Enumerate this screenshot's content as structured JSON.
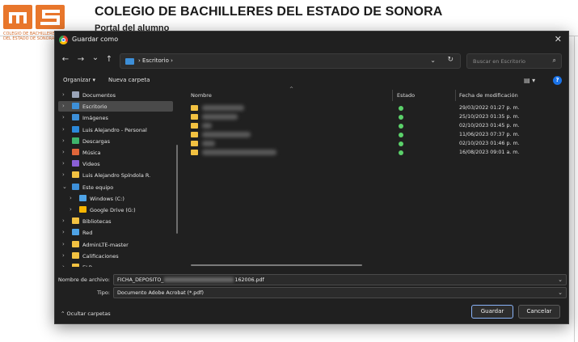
{
  "background": {
    "title": "COLEGIO DE BACHILLERES DEL ESTADO DE SONORA",
    "subtitle": "Portal del alumno",
    "logo_text_line1": "COLEGIO DE BACHILLERES",
    "logo_text_line2": "DEL ESTADO DE SONORA"
  },
  "dialog": {
    "title": "Guardar como",
    "close_glyph": "✕",
    "nav": {
      "back": "←",
      "forward": "→",
      "recent": "⌄",
      "up": "↑"
    },
    "address": {
      "breadcrumb": "› Escritorio ›",
      "dropdown": "⌄",
      "refresh": "↻"
    },
    "search": {
      "placeholder": "Buscar en Escritorio",
      "icon": "⌕"
    },
    "toolbar": {
      "organize": "Organizar ▾",
      "new_folder": "Nueva carpeta",
      "view_glyph": "▤ ▾",
      "help_glyph": "?"
    },
    "sidebar": [
      {
        "label": "Documentos",
        "icon": "document-icon",
        "color": "#9aa4b8",
        "indent": 0,
        "chevron": "›",
        "selected": false
      },
      {
        "label": "Escritorio",
        "icon": "desktop-icon",
        "color": "#3d8fd8",
        "indent": 0,
        "chevron": "›",
        "selected": true
      },
      {
        "label": "Imágenes",
        "icon": "pictures-icon",
        "color": "#3d8fd8",
        "indent": 0,
        "chevron": "›",
        "selected": false
      },
      {
        "label": "Luis Alejandro - Personal",
        "icon": "cloud-icon",
        "color": "#2b88d9",
        "indent": 0,
        "chevron": "›",
        "selected": false
      },
      {
        "label": "Descargas",
        "icon": "download-icon",
        "color": "#3fb36b",
        "indent": 0,
        "chevron": "›",
        "selected": false
      },
      {
        "label": "Música",
        "icon": "music-icon",
        "color": "#e0663a",
        "indent": 0,
        "chevron": "›",
        "selected": false
      },
      {
        "label": "Videos",
        "icon": "videos-icon",
        "color": "#8a5fd6",
        "indent": 0,
        "chevron": "›",
        "selected": false
      },
      {
        "label": "Luis Alejandro Spíndola R.",
        "icon": "folder-icon",
        "color": "#f2c141",
        "indent": 0,
        "chevron": "›",
        "selected": false
      },
      {
        "label": "Este equipo",
        "icon": "computer-icon",
        "color": "#3d8fd8",
        "indent": 0,
        "chevron": "⌄",
        "selected": false
      },
      {
        "label": "Windows (C:)",
        "icon": "drive-icon",
        "color": "#4ea3e6",
        "indent": 1,
        "chevron": "›",
        "selected": false
      },
      {
        "label": "Google Drive (G:)",
        "icon": "google-drive-icon",
        "color": "#f7b500",
        "indent": 1,
        "chevron": "›",
        "selected": false
      },
      {
        "label": "Bibliotecas",
        "icon": "folder-icon",
        "color": "#f2c141",
        "indent": 0,
        "chevron": "›",
        "selected": false
      },
      {
        "label": "Red",
        "icon": "network-icon",
        "color": "#4ea3e6",
        "indent": 0,
        "chevron": "›",
        "selected": false
      },
      {
        "label": "AdminLTE-master",
        "icon": "folder-icon",
        "color": "#f2c141",
        "indent": 0,
        "chevron": "›",
        "selected": false
      },
      {
        "label": "Calificaciones",
        "icon": "folder-icon",
        "color": "#f2c141",
        "indent": 0,
        "chevron": "›",
        "selected": false
      },
      {
        "label": "ELR",
        "icon": "folder-icon",
        "color": "#f2c141",
        "indent": 0,
        "chevron": "›",
        "selected": false
      }
    ],
    "columns": {
      "name": "Nombre",
      "status": "Estado",
      "modified": "Fecha de modificación",
      "sort_glyph": "^"
    },
    "files": [
      {
        "modified": "29/03/2022 01:27 p. m."
      },
      {
        "modified": "25/10/2023 01:35 p. m."
      },
      {
        "modified": "02/10/2023 01:45 p. m."
      },
      {
        "modified": "11/06/2023 07:37 p. m."
      },
      {
        "modified": "02/10/2023 01:46 p. m."
      },
      {
        "modified": "16/08/2023 09:01 a. m."
      }
    ],
    "filename": {
      "label": "Nombre de archivo:",
      "value_prefix": "FICHA_DEPOSITO_",
      "value_suffix": "162006.pdf",
      "dropdown": "⌄"
    },
    "filetype": {
      "label": "Tipo:",
      "value": "Documento Adobe Acrobat (*.pdf)",
      "dropdown": "⌄"
    },
    "footer": {
      "hide_folders": "⌃  Ocultar carpetas",
      "save": "Guardar",
      "cancel": "Cancelar"
    }
  }
}
